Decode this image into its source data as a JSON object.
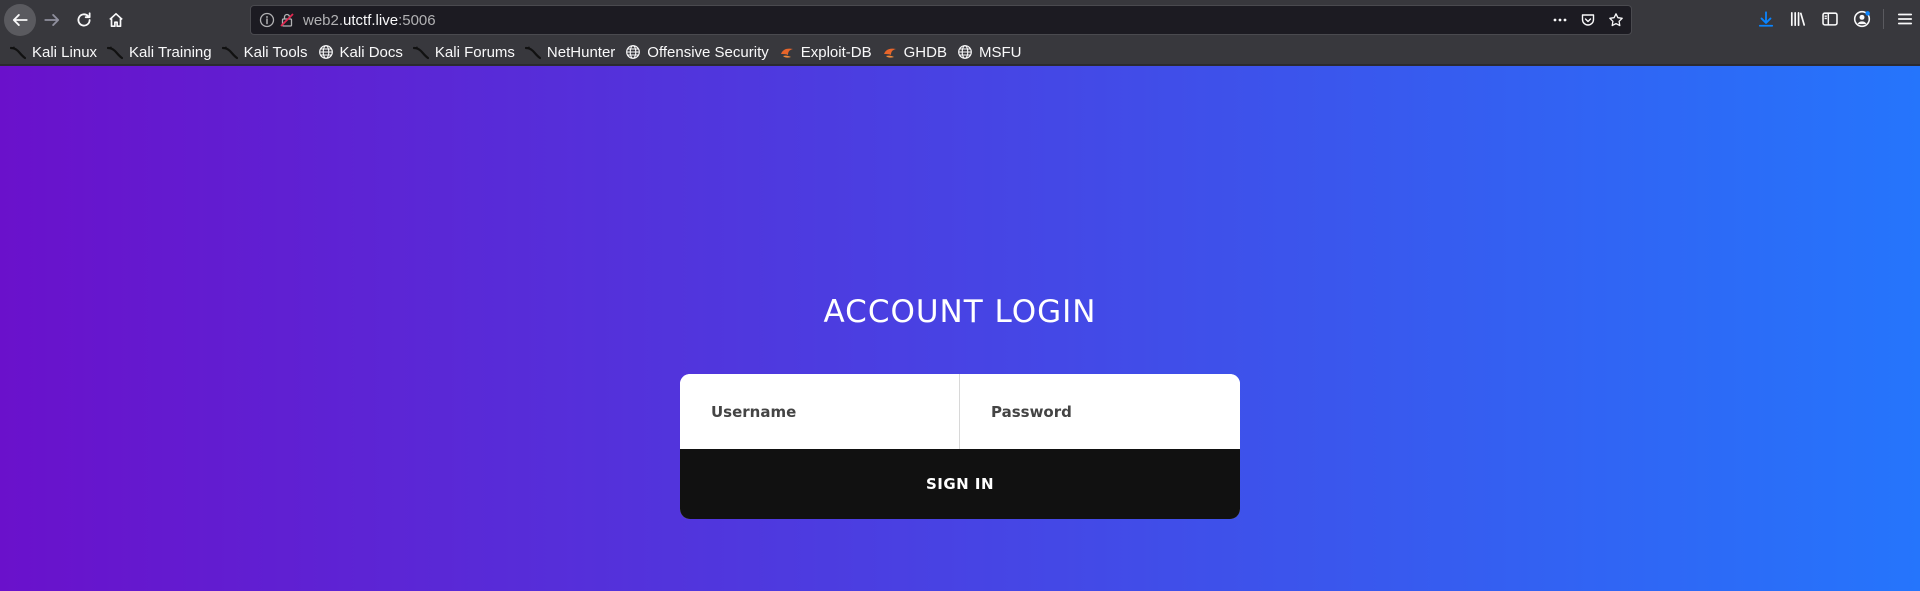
{
  "browser": {
    "url": {
      "prefix": "web2.",
      "host": "utctf.live",
      "suffix": ":5006"
    },
    "accent_color": "#0a84ff"
  },
  "bookmarks": [
    {
      "label": "Kali Linux",
      "icon": "kali-dragon-icon"
    },
    {
      "label": "Kali Training",
      "icon": "kali-dragon-icon"
    },
    {
      "label": "Kali Tools",
      "icon": "kali-dragon-icon"
    },
    {
      "label": "Kali Docs",
      "icon": "globe-icon"
    },
    {
      "label": "Kali Forums",
      "icon": "kali-dragon-icon"
    },
    {
      "label": "NetHunter",
      "icon": "kali-dragon-icon"
    },
    {
      "label": "Offensive Security",
      "icon": "globe-icon"
    },
    {
      "label": "Exploit-DB",
      "icon": "exploitdb-icon"
    },
    {
      "label": "GHDB",
      "icon": "exploitdb-icon"
    },
    {
      "label": "MSFU",
      "icon": "globe-icon"
    }
  ],
  "page": {
    "title": "ACCOUNT LOGIN",
    "username_placeholder": "Username",
    "password_placeholder": "Password",
    "signin_label": "SIGN IN",
    "gradient_start": "#6a11cb",
    "gradient_end": "#2575fc"
  }
}
